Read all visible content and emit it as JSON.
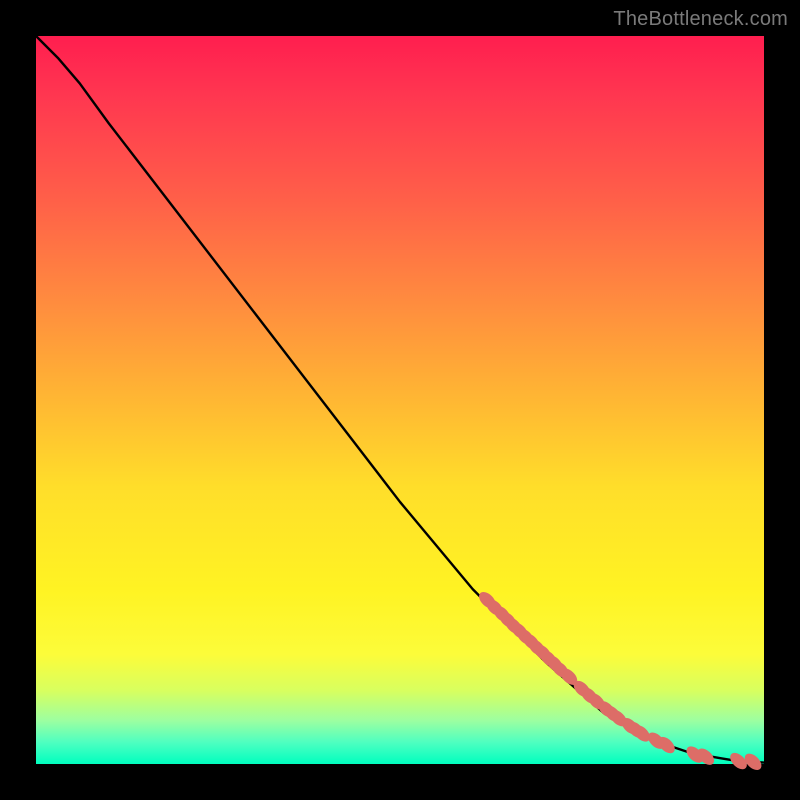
{
  "watermark": "TheBottleneck.com",
  "chart_data": {
    "type": "line",
    "title": "",
    "xlabel": "",
    "ylabel": "",
    "xlim": [
      0,
      100
    ],
    "ylim": [
      0,
      100
    ],
    "grid": false,
    "legend": false,
    "series": [
      {
        "name": "curve",
        "style": "line",
        "color": "#000000",
        "points": [
          [
            0,
            100
          ],
          [
            3,
            97
          ],
          [
            6,
            93.5
          ],
          [
            10,
            88
          ],
          [
            20,
            75
          ],
          [
            30,
            62
          ],
          [
            40,
            49
          ],
          [
            50,
            36
          ],
          [
            60,
            24
          ],
          [
            70,
            14
          ],
          [
            78,
            7
          ],
          [
            84,
            3.5
          ],
          [
            90,
            1.5
          ],
          [
            94,
            0.8
          ],
          [
            97,
            0.3
          ],
          [
            100,
            0.2
          ]
        ]
      },
      {
        "name": "markers",
        "style": "scatter",
        "color": "#dd6d67",
        "points": [
          [
            62,
            22.5
          ],
          [
            63,
            21.5
          ],
          [
            64,
            20.6
          ],
          [
            64.8,
            19.8
          ],
          [
            65.6,
            19.0
          ],
          [
            66.4,
            18.3
          ],
          [
            67.2,
            17.5
          ],
          [
            68.0,
            16.8
          ],
          [
            68.8,
            16.0
          ],
          [
            69.6,
            15.3
          ],
          [
            70.4,
            14.5
          ],
          [
            71.2,
            13.8
          ],
          [
            72.0,
            13.0
          ],
          [
            73.2,
            12.0
          ],
          [
            75.0,
            10.3
          ],
          [
            76.0,
            9.4
          ],
          [
            77.0,
            8.6
          ],
          [
            78.4,
            7.5
          ],
          [
            79.2,
            6.9
          ],
          [
            80.0,
            6.3
          ],
          [
            81.6,
            5.2
          ],
          [
            82.4,
            4.7
          ],
          [
            83.2,
            4.2
          ],
          [
            85.2,
            3.2
          ],
          [
            86.6,
            2.6
          ],
          [
            90.5,
            1.3
          ],
          [
            92.0,
            1.0
          ],
          [
            96.5,
            0.4
          ],
          [
            98.5,
            0.3
          ]
        ]
      }
    ]
  }
}
